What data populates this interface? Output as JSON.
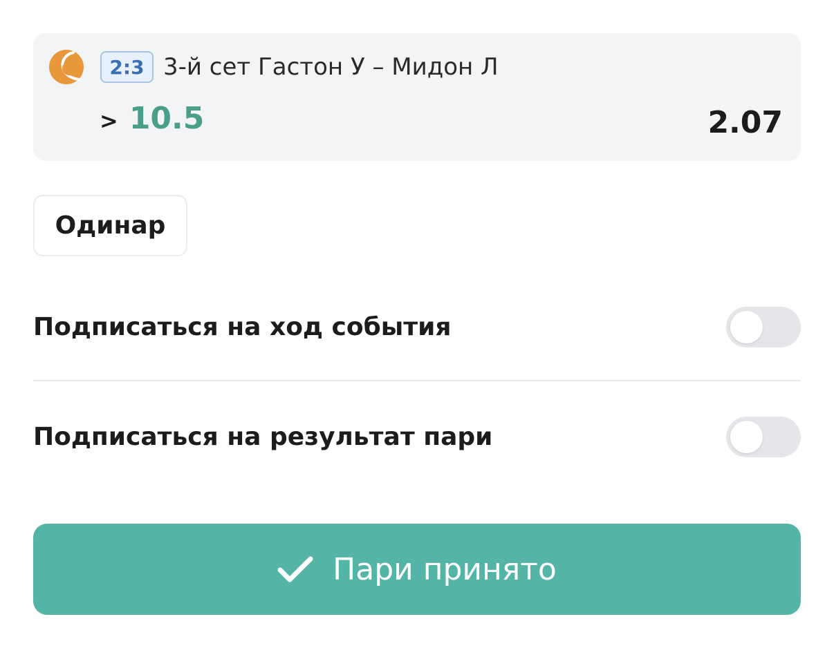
{
  "bet": {
    "sport_icon": "tennis-ball-icon",
    "score": "2:3",
    "event": "3-й сет Гастон У – Мидон Л",
    "operator": ">",
    "value": "10.5",
    "odds": "2.07"
  },
  "bet_type": {
    "label": "Одинар"
  },
  "subscriptions": [
    {
      "label": "Подписаться на ход события",
      "enabled": false
    },
    {
      "label": "Подписаться на результат пари",
      "enabled": false
    }
  ],
  "action": {
    "label": "Пари принято",
    "icon": "checkmark-icon"
  },
  "colors": {
    "accent": "#54b5a6",
    "value_green": "#4a9e8a",
    "tennis_orange": "#e8973a",
    "score_blue": "#3a6fb3",
    "card_bg": "#f3f4f6"
  }
}
